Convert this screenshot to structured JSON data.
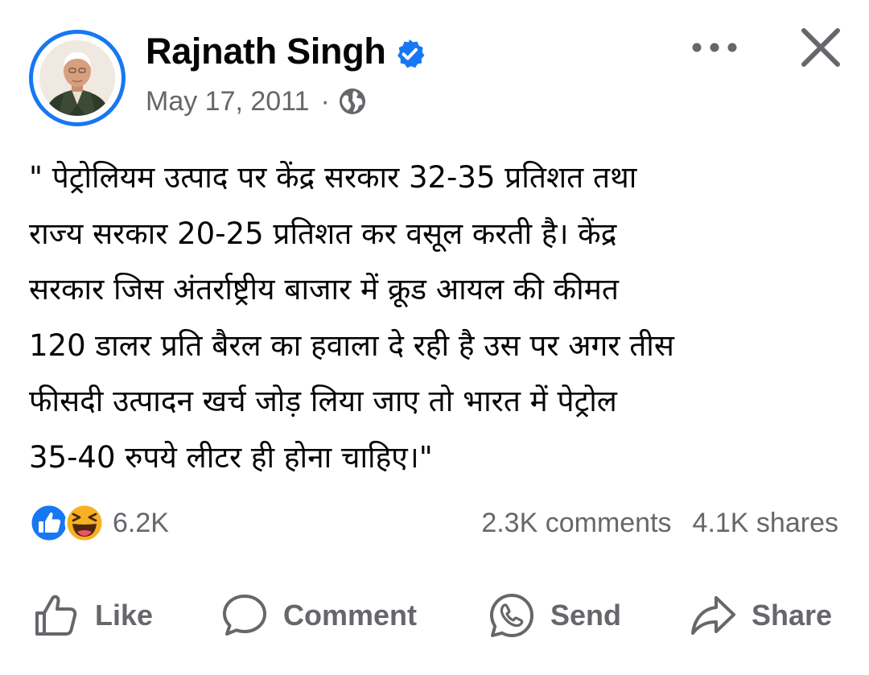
{
  "post": {
    "author": "Rajnath Singh",
    "date": "May 17, 2011",
    "separator": "·",
    "text": "\" पेट्रोलियम उत्पाद पर केंद्र सरकार 32-35 प्रतिशत तथा\nराज्य सरकार 20-25 प्रतिशत कर वसूल करती है। केंद्र\nसरकार जिस अंतर्राष्ट्रीय बाजार में क्रूड आयल की कीमत\n120 डालर प्रति बैरल का हवाला दे रही है उस पर अगर तीस\nफीसदी उत्पादन खर्च जोड़ लिया जाए तो भारत में पेट्रोल\n35-40 रुपये लीटर ही होना चाहिए।\""
  },
  "stats": {
    "reactions": "6.2K",
    "comments": "2.3K comments",
    "shares": "4.1K shares"
  },
  "actions": {
    "like": "Like",
    "comment": "Comment",
    "send": "Send",
    "share": "Share"
  },
  "icons": {
    "verified": "verified-badge-icon",
    "audience": "globe-icon",
    "more": "more-dots-icon",
    "close": "close-icon",
    "like_reaction": "like-reaction-icon",
    "haha_reaction": "haha-reaction-icon"
  },
  "colors": {
    "brand_blue": "#1877f2",
    "secondary_text": "#65676b",
    "primary_text": "#050505",
    "haha_yellow": "#f7b125"
  }
}
